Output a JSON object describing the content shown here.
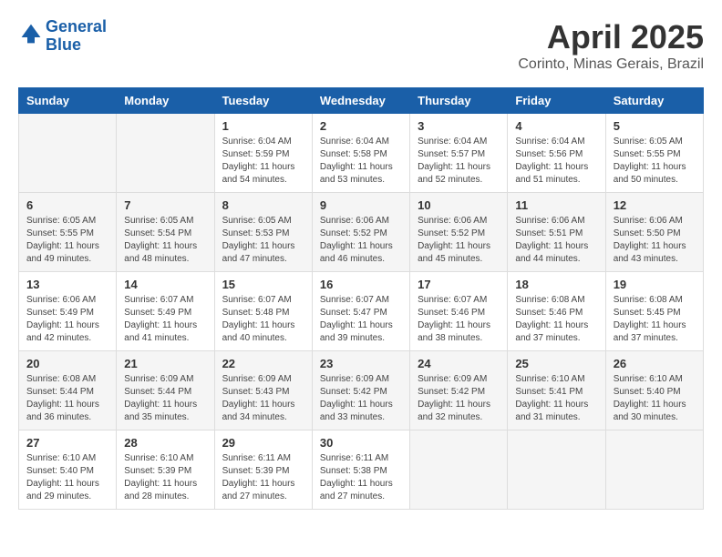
{
  "logo": {
    "line1": "General",
    "line2": "Blue"
  },
  "title": "April 2025",
  "location": "Corinto, Minas Gerais, Brazil",
  "days_of_week": [
    "Sunday",
    "Monday",
    "Tuesday",
    "Wednesday",
    "Thursday",
    "Friday",
    "Saturday"
  ],
  "weeks": [
    [
      null,
      null,
      {
        "day": "1",
        "sunrise": "Sunrise: 6:04 AM",
        "sunset": "Sunset: 5:59 PM",
        "daylight": "Daylight: 11 hours and 54 minutes."
      },
      {
        "day": "2",
        "sunrise": "Sunrise: 6:04 AM",
        "sunset": "Sunset: 5:58 PM",
        "daylight": "Daylight: 11 hours and 53 minutes."
      },
      {
        "day": "3",
        "sunrise": "Sunrise: 6:04 AM",
        "sunset": "Sunset: 5:57 PM",
        "daylight": "Daylight: 11 hours and 52 minutes."
      },
      {
        "day": "4",
        "sunrise": "Sunrise: 6:04 AM",
        "sunset": "Sunset: 5:56 PM",
        "daylight": "Daylight: 11 hours and 51 minutes."
      },
      {
        "day": "5",
        "sunrise": "Sunrise: 6:05 AM",
        "sunset": "Sunset: 5:55 PM",
        "daylight": "Daylight: 11 hours and 50 minutes."
      }
    ],
    [
      {
        "day": "6",
        "sunrise": "Sunrise: 6:05 AM",
        "sunset": "Sunset: 5:55 PM",
        "daylight": "Daylight: 11 hours and 49 minutes."
      },
      {
        "day": "7",
        "sunrise": "Sunrise: 6:05 AM",
        "sunset": "Sunset: 5:54 PM",
        "daylight": "Daylight: 11 hours and 48 minutes."
      },
      {
        "day": "8",
        "sunrise": "Sunrise: 6:05 AM",
        "sunset": "Sunset: 5:53 PM",
        "daylight": "Daylight: 11 hours and 47 minutes."
      },
      {
        "day": "9",
        "sunrise": "Sunrise: 6:06 AM",
        "sunset": "Sunset: 5:52 PM",
        "daylight": "Daylight: 11 hours and 46 minutes."
      },
      {
        "day": "10",
        "sunrise": "Sunrise: 6:06 AM",
        "sunset": "Sunset: 5:52 PM",
        "daylight": "Daylight: 11 hours and 45 minutes."
      },
      {
        "day": "11",
        "sunrise": "Sunrise: 6:06 AM",
        "sunset": "Sunset: 5:51 PM",
        "daylight": "Daylight: 11 hours and 44 minutes."
      },
      {
        "day": "12",
        "sunrise": "Sunrise: 6:06 AM",
        "sunset": "Sunset: 5:50 PM",
        "daylight": "Daylight: 11 hours and 43 minutes."
      }
    ],
    [
      {
        "day": "13",
        "sunrise": "Sunrise: 6:06 AM",
        "sunset": "Sunset: 5:49 PM",
        "daylight": "Daylight: 11 hours and 42 minutes."
      },
      {
        "day": "14",
        "sunrise": "Sunrise: 6:07 AM",
        "sunset": "Sunset: 5:49 PM",
        "daylight": "Daylight: 11 hours and 41 minutes."
      },
      {
        "day": "15",
        "sunrise": "Sunrise: 6:07 AM",
        "sunset": "Sunset: 5:48 PM",
        "daylight": "Daylight: 11 hours and 40 minutes."
      },
      {
        "day": "16",
        "sunrise": "Sunrise: 6:07 AM",
        "sunset": "Sunset: 5:47 PM",
        "daylight": "Daylight: 11 hours and 39 minutes."
      },
      {
        "day": "17",
        "sunrise": "Sunrise: 6:07 AM",
        "sunset": "Sunset: 5:46 PM",
        "daylight": "Daylight: 11 hours and 38 minutes."
      },
      {
        "day": "18",
        "sunrise": "Sunrise: 6:08 AM",
        "sunset": "Sunset: 5:46 PM",
        "daylight": "Daylight: 11 hours and 37 minutes."
      },
      {
        "day": "19",
        "sunrise": "Sunrise: 6:08 AM",
        "sunset": "Sunset: 5:45 PM",
        "daylight": "Daylight: 11 hours and 37 minutes."
      }
    ],
    [
      {
        "day": "20",
        "sunrise": "Sunrise: 6:08 AM",
        "sunset": "Sunset: 5:44 PM",
        "daylight": "Daylight: 11 hours and 36 minutes."
      },
      {
        "day": "21",
        "sunrise": "Sunrise: 6:09 AM",
        "sunset": "Sunset: 5:44 PM",
        "daylight": "Daylight: 11 hours and 35 minutes."
      },
      {
        "day": "22",
        "sunrise": "Sunrise: 6:09 AM",
        "sunset": "Sunset: 5:43 PM",
        "daylight": "Daylight: 11 hours and 34 minutes."
      },
      {
        "day": "23",
        "sunrise": "Sunrise: 6:09 AM",
        "sunset": "Sunset: 5:42 PM",
        "daylight": "Daylight: 11 hours and 33 minutes."
      },
      {
        "day": "24",
        "sunrise": "Sunrise: 6:09 AM",
        "sunset": "Sunset: 5:42 PM",
        "daylight": "Daylight: 11 hours and 32 minutes."
      },
      {
        "day": "25",
        "sunrise": "Sunrise: 6:10 AM",
        "sunset": "Sunset: 5:41 PM",
        "daylight": "Daylight: 11 hours and 31 minutes."
      },
      {
        "day": "26",
        "sunrise": "Sunrise: 6:10 AM",
        "sunset": "Sunset: 5:40 PM",
        "daylight": "Daylight: 11 hours and 30 minutes."
      }
    ],
    [
      {
        "day": "27",
        "sunrise": "Sunrise: 6:10 AM",
        "sunset": "Sunset: 5:40 PM",
        "daylight": "Daylight: 11 hours and 29 minutes."
      },
      {
        "day": "28",
        "sunrise": "Sunrise: 6:10 AM",
        "sunset": "Sunset: 5:39 PM",
        "daylight": "Daylight: 11 hours and 28 minutes."
      },
      {
        "day": "29",
        "sunrise": "Sunrise: 6:11 AM",
        "sunset": "Sunset: 5:39 PM",
        "daylight": "Daylight: 11 hours and 27 minutes."
      },
      {
        "day": "30",
        "sunrise": "Sunrise: 6:11 AM",
        "sunset": "Sunset: 5:38 PM",
        "daylight": "Daylight: 11 hours and 27 minutes."
      },
      null,
      null,
      null
    ]
  ]
}
